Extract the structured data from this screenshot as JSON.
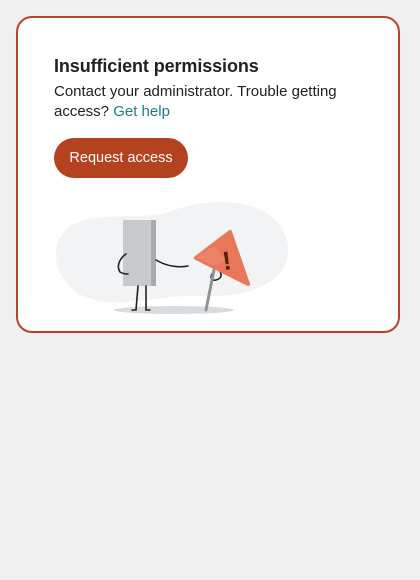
{
  "dialog": {
    "title": "Insufficient permissions",
    "description": "Contact your administrator. Trouble getting access?",
    "help_link": "Get help",
    "button_label": "Request access"
  },
  "illustration": {
    "icon": "warning-sign-illustration",
    "warning_glyph": "!"
  },
  "colors": {
    "accent": "#b5421f",
    "border": "#b5452a",
    "link": "#1a7f84",
    "warning": "#e8785a",
    "page_background": "#f0f0f0"
  }
}
